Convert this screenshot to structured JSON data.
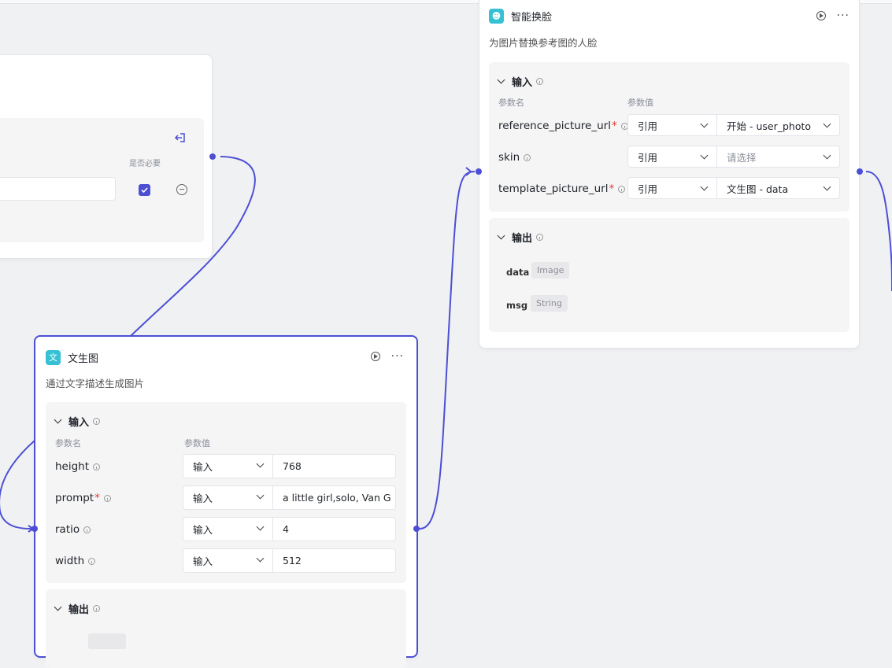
{
  "colors": {
    "accent": "#4c4fd4",
    "node_icon": "#35c1d3",
    "required": "#e53935"
  },
  "start_node": {
    "required_col_label": "是否必要",
    "checkbox_checked": true,
    "icons": [
      "exit-icon",
      "remove-circle-icon",
      "checkbox-icon"
    ]
  },
  "face_swap_node": {
    "icon_glyph": "☻",
    "title": "智能换脸",
    "description": "为图片替换参考图的人脸",
    "input_section": "输入",
    "col_param_name": "参数名",
    "col_param_value": "参数值",
    "params": [
      {
        "name": "reference_picture_url",
        "required": true,
        "mode": "引用",
        "value": "开始 - user_photo",
        "placeholder": false
      },
      {
        "name": "skin",
        "required": false,
        "mode": "引用",
        "value": "请选择",
        "placeholder": true
      },
      {
        "name": "template_picture_url",
        "required": true,
        "mode": "引用",
        "value": "文生图 - data",
        "placeholder": false
      }
    ],
    "output_section": "输出",
    "outputs": [
      {
        "name": "data",
        "type": "Image"
      },
      {
        "name": "msg",
        "type": "String"
      }
    ]
  },
  "text2img_node": {
    "icon_glyph": "文",
    "title": "文生图",
    "description": "通过文字描述生成图片",
    "input_section": "输入",
    "col_param_name": "参数名",
    "col_param_value": "参数值",
    "params": [
      {
        "name": "height",
        "required": false,
        "mode": "输入",
        "value": "768"
      },
      {
        "name": "prompt",
        "required": true,
        "mode": "输入",
        "value": "a little girl,solo, Van G"
      },
      {
        "name": "ratio",
        "required": false,
        "mode": "输入",
        "value": "4"
      },
      {
        "name": "width",
        "required": false,
        "mode": "输入",
        "value": "512"
      }
    ],
    "output_section": "输出",
    "required_mark": "*"
  }
}
